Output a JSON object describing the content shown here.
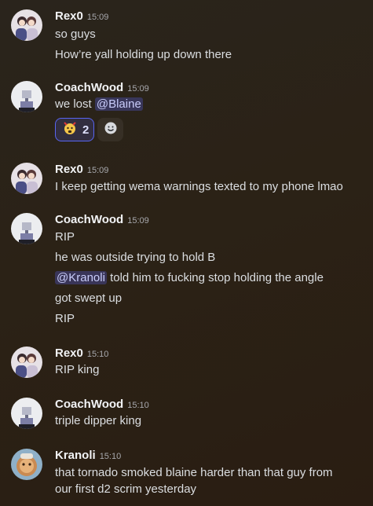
{
  "messages": [
    {
      "author": "Rex0",
      "time": "15:09",
      "lines": [
        "so guys",
        "How’re yall holding up down there"
      ]
    },
    {
      "author": "CoachWood",
      "time": "15:09",
      "line1_prefix": "we lost ",
      "line1_mention": "@Blaine",
      "reaction": {
        "emoji": "angry-face-icon",
        "count": "2"
      }
    },
    {
      "author": "Rex0",
      "time": "15:09",
      "lines": [
        "I keep getting wema warnings texted to my phone lmao"
      ]
    },
    {
      "author": "CoachWood",
      "time": "15:09",
      "line1": "RIP",
      "line2": "he was outside trying to hold B",
      "line3_mention": "@Kranoli",
      "line3_suffix": " told him to fucking stop holding the angle",
      "line4": "got swept up",
      "line5": "RIP"
    },
    {
      "author": "Rex0",
      "time": "15:10",
      "lines": [
        "RIP king"
      ]
    },
    {
      "author": "CoachWood",
      "time": "15:10",
      "lines": [
        "triple dipper king"
      ]
    },
    {
      "author": "Kranoli",
      "time": "15:10",
      "lines": [
        "that tornado smoked blaine harder than that guy from",
        "our first d2 scrim yesterday"
      ]
    }
  ]
}
